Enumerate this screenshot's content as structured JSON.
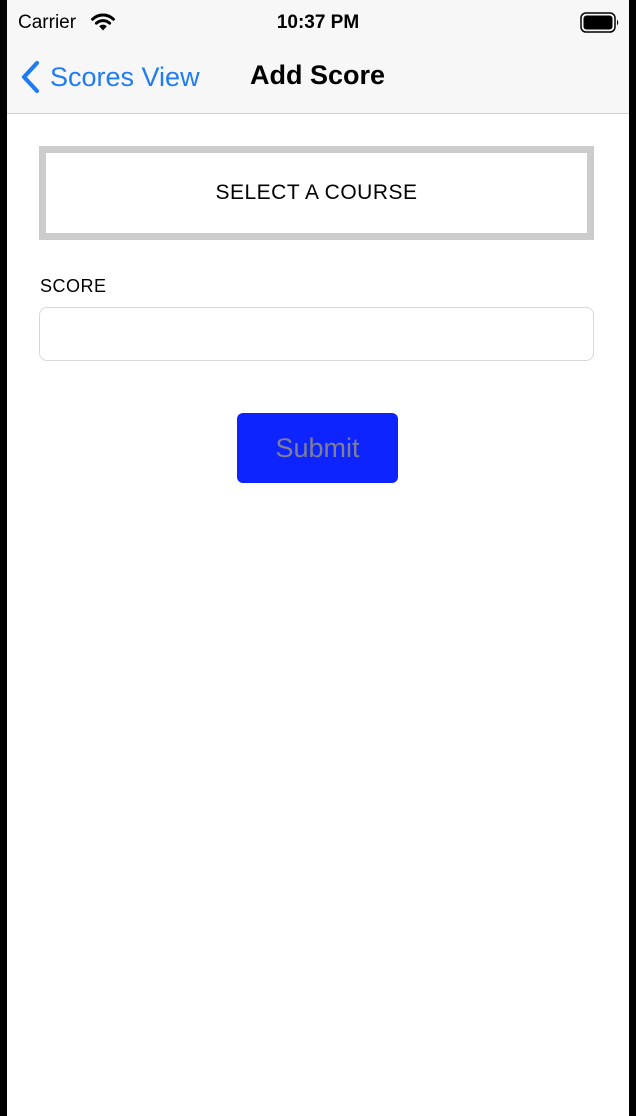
{
  "status_bar": {
    "carrier": "Carrier",
    "time": "10:37 PM",
    "wifi_icon": "wifi-icon",
    "battery_icon": "battery-icon"
  },
  "nav_bar": {
    "back_label": "Scores View",
    "back_icon": "chevron-left-icon",
    "title": "Add Score"
  },
  "form": {
    "course_button_label": "SELECT A COURSE",
    "score_label": "SCORE",
    "score_value": "",
    "score_placeholder": "",
    "submit_label": "Submit"
  },
  "colors": {
    "accent": "#1f7cf2",
    "submit_background": "#0d24ff",
    "submit_text": "#7f7f8f",
    "course_border": "#cccccc"
  }
}
